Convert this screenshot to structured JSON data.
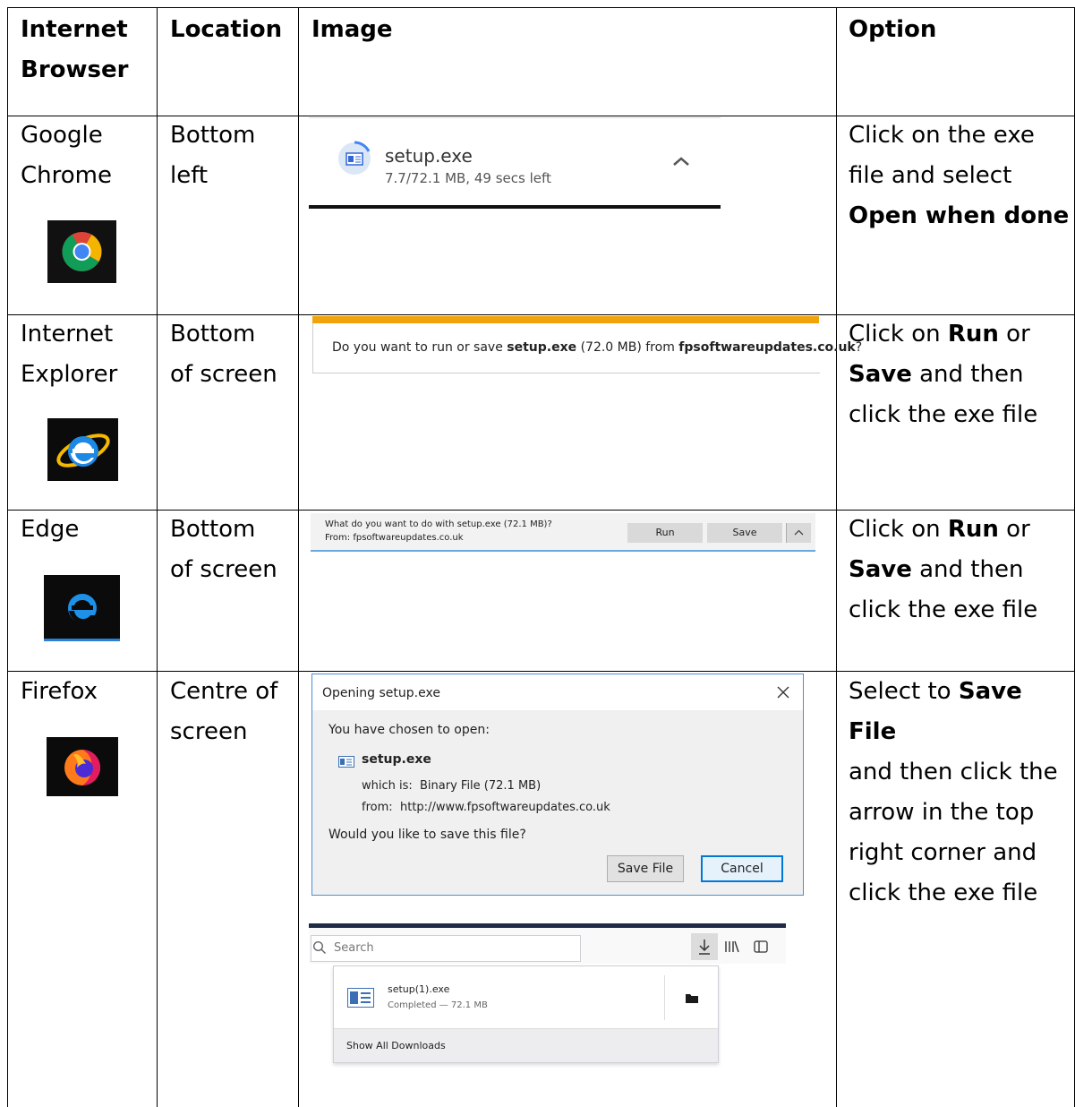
{
  "table": {
    "headers": {
      "browser": "Internet\nBrowser",
      "location": "Location",
      "image": "Image",
      "option": "Option"
    },
    "rows": [
      {
        "browser": "Google\nChrome",
        "location": "Bottom\nleft",
        "option": [
          "Click on the exe\nfile and select\n",
          "Open when done",
          ""
        ],
        "icon": "chrome-logo"
      },
      {
        "browser": "Internet\nExplorer",
        "location": "Bottom\nof screen",
        "option": [
          "Click on ",
          "Run",
          " or\n",
          "Save",
          " and then\nclick the exe file"
        ],
        "icon": "internet-explorer-logo"
      },
      {
        "browser": "Edge",
        "location": "Bottom\nof screen",
        "option": [
          "Click on ",
          "Run",
          " or\n",
          "Save",
          " and then\nclick the exe file"
        ],
        "icon": "edge-logo"
      },
      {
        "browser": "Firefox",
        "location": "Centre of\nscreen",
        "option": [
          "Select to ",
          "Save File",
          "\nand then click the\narrow in the top\nright corner and\nclick the exe file"
        ],
        "icon": "firefox-logo"
      }
    ]
  },
  "chrome_download": {
    "filename": "setup.exe",
    "status": "7.7/72.1 MB, 49 secs left"
  },
  "ie_bar": {
    "prefix": "Do you want to run or save ",
    "file": "setup.exe",
    "size": " (72.0 MB) from ",
    "site": "fpsoftwareupdates.co.uk",
    "suffix": "?"
  },
  "edge_bar": {
    "line1": "What do you want to do with setup.exe (72.1 MB)?",
    "line2": "From: fpsoftwareupdates.co.uk",
    "run": "Run",
    "save": "Save"
  },
  "firefox_dialog": {
    "title": "Opening setup.exe",
    "chosen": "You have chosen to open:",
    "file": "setup.exe",
    "which_label": "which is:",
    "which_value": "Binary File (72.1 MB)",
    "from_label": "from:",
    "from_value": "http://www.fpsoftwareupdates.co.uk",
    "question": "Would you like to save this file?",
    "save_button": "Save File",
    "cancel_button": "Cancel"
  },
  "firefox_downloads": {
    "search_placeholder": "Search",
    "file": "setup(1).exe",
    "status": "Completed — 72.1 MB",
    "show_all": "Show All Downloads"
  },
  "colors": {
    "ie_accent": "#f0a30a",
    "firefox_dialog_border": "#4a8fd8",
    "firefox_toolbar": "#1f2a44"
  }
}
